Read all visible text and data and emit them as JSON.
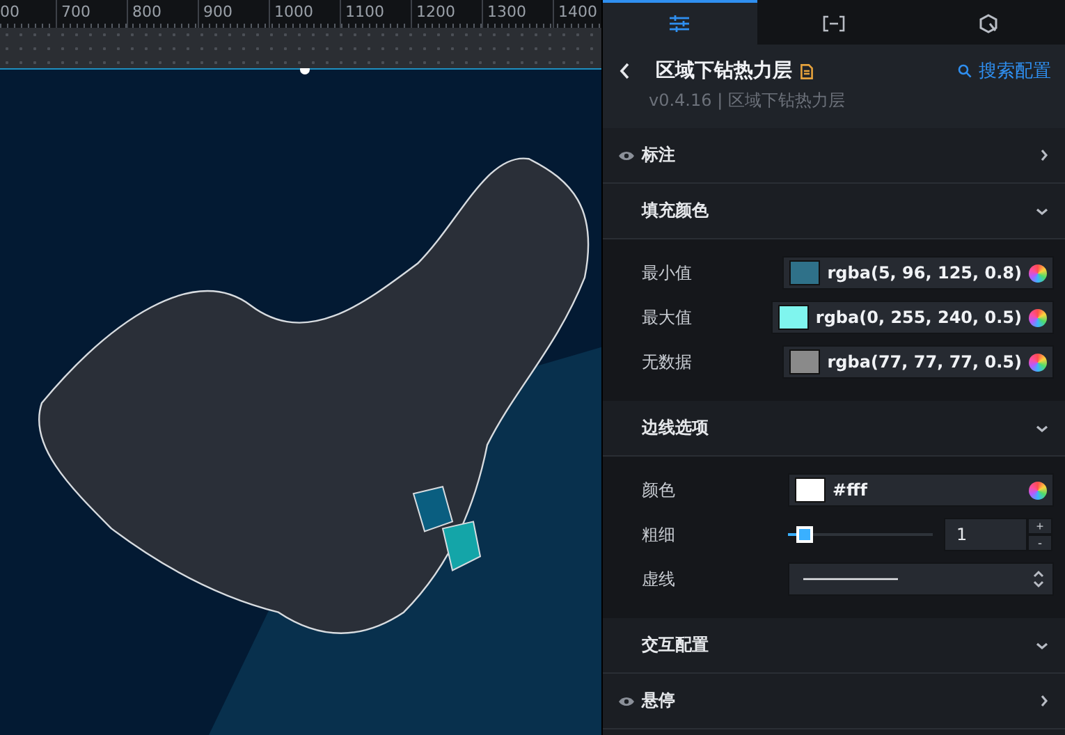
{
  "ruler": {
    "labels": [
      "00",
      "700",
      "800",
      "900",
      "1000",
      "1100",
      "1200",
      "1300",
      "1400"
    ]
  },
  "panel": {
    "tabs": [
      {
        "kind": "sliders",
        "selected": true
      },
      {
        "kind": "bracket",
        "selected": false
      },
      {
        "kind": "cycle",
        "selected": false
      }
    ],
    "header": {
      "title": "区域下钻热力层",
      "version": "v0.4.16 | 区域下钻热力层",
      "search_link": "搜索配置"
    },
    "sections": [
      {
        "kind": "switchable",
        "title": "标注",
        "expanded": false
      },
      {
        "kind": "group",
        "title": "填充颜色",
        "fields": [
          {
            "kind": "color",
            "label": "最小值",
            "value": "rgba(5, 96, 125, 0.8)",
            "color": "#2f7189"
          },
          {
            "kind": "color",
            "label": "最大值",
            "value": "rgba(0, 255, 240, 0.5)",
            "color": "#7ff5ee"
          },
          {
            "kind": "color",
            "label": "无数据",
            "value": "rgba(77, 77, 77, 0.5)",
            "color": "#8a8a8a"
          }
        ]
      },
      {
        "kind": "group",
        "title": "边线选项",
        "fields": [
          {
            "kind": "color",
            "label": "颜色",
            "value": "#fff",
            "color": "#ffffff"
          },
          {
            "kind": "slider",
            "label": "粗细",
            "level": 0.06,
            "value": "1",
            "stepper": [
              "+",
              "-"
            ]
          },
          {
            "kind": "line-select",
            "label": "虚线"
          }
        ]
      },
      {
        "kind": "group",
        "title": "交互配置"
      },
      {
        "kind": "switchable",
        "title": "悬停",
        "expanded": false
      }
    ]
  }
}
